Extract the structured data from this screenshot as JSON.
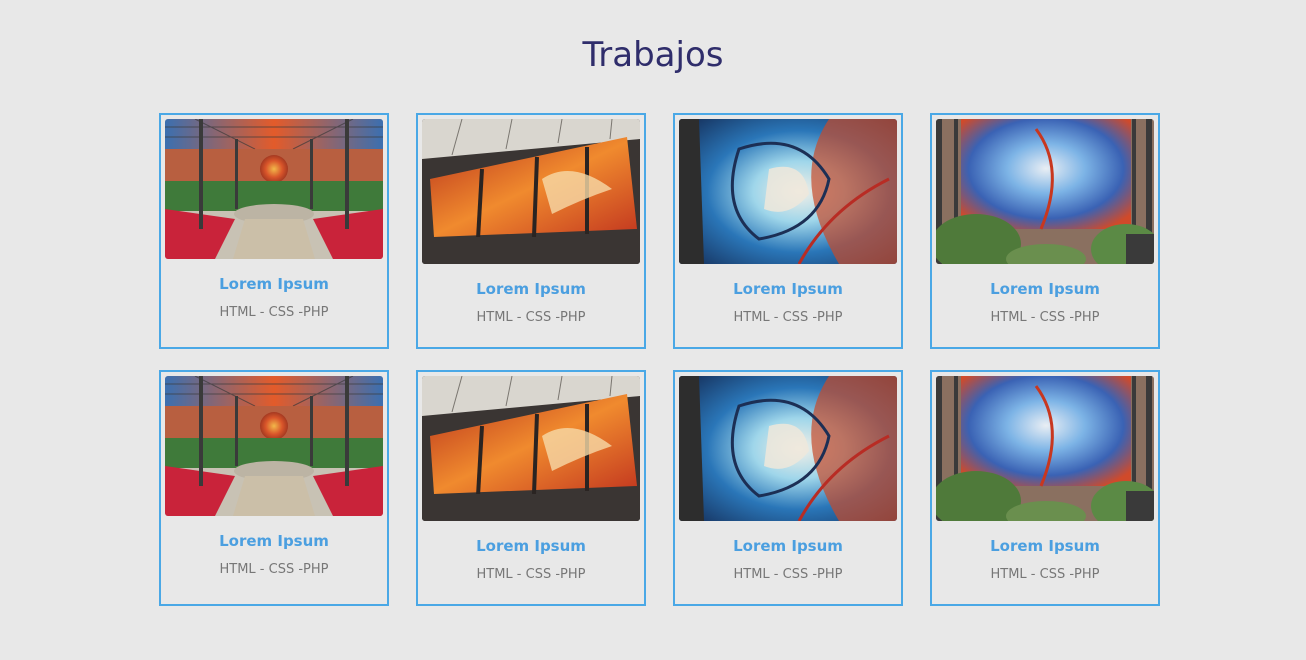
{
  "page": {
    "title": "Trabajos"
  },
  "colors": {
    "background": "#e8e8e8",
    "title": "#2f2d6b",
    "accent": "#4aa8e6",
    "card_title": "#4b9fe0",
    "tags": "#777777"
  },
  "cards": [
    {
      "title": "Lorem Ipsum",
      "tags": "HTML - CSS -PHP",
      "image": "greenhouse-garden-image"
    },
    {
      "title": "Lorem Ipsum",
      "tags": "HTML - CSS -PHP",
      "image": "red-stained-glass-image"
    },
    {
      "title": "Lorem Ipsum",
      "tags": "HTML - CSS -PHP",
      "image": "blue-swirl-stained-glass-image"
    },
    {
      "title": "Lorem Ipsum",
      "tags": "HTML - CSS -PHP",
      "image": "blue-mural-plants-image"
    },
    {
      "title": "Lorem Ipsum",
      "tags": "HTML - CSS -PHP",
      "image": "greenhouse-garden-image"
    },
    {
      "title": "Lorem Ipsum",
      "tags": "HTML - CSS -PHP",
      "image": "red-stained-glass-image"
    },
    {
      "title": "Lorem Ipsum",
      "tags": "HTML - CSS -PHP",
      "image": "blue-swirl-stained-glass-image"
    },
    {
      "title": "Lorem Ipsum",
      "tags": "HTML - CSS -PHP",
      "image": "blue-mural-plants-image"
    }
  ]
}
